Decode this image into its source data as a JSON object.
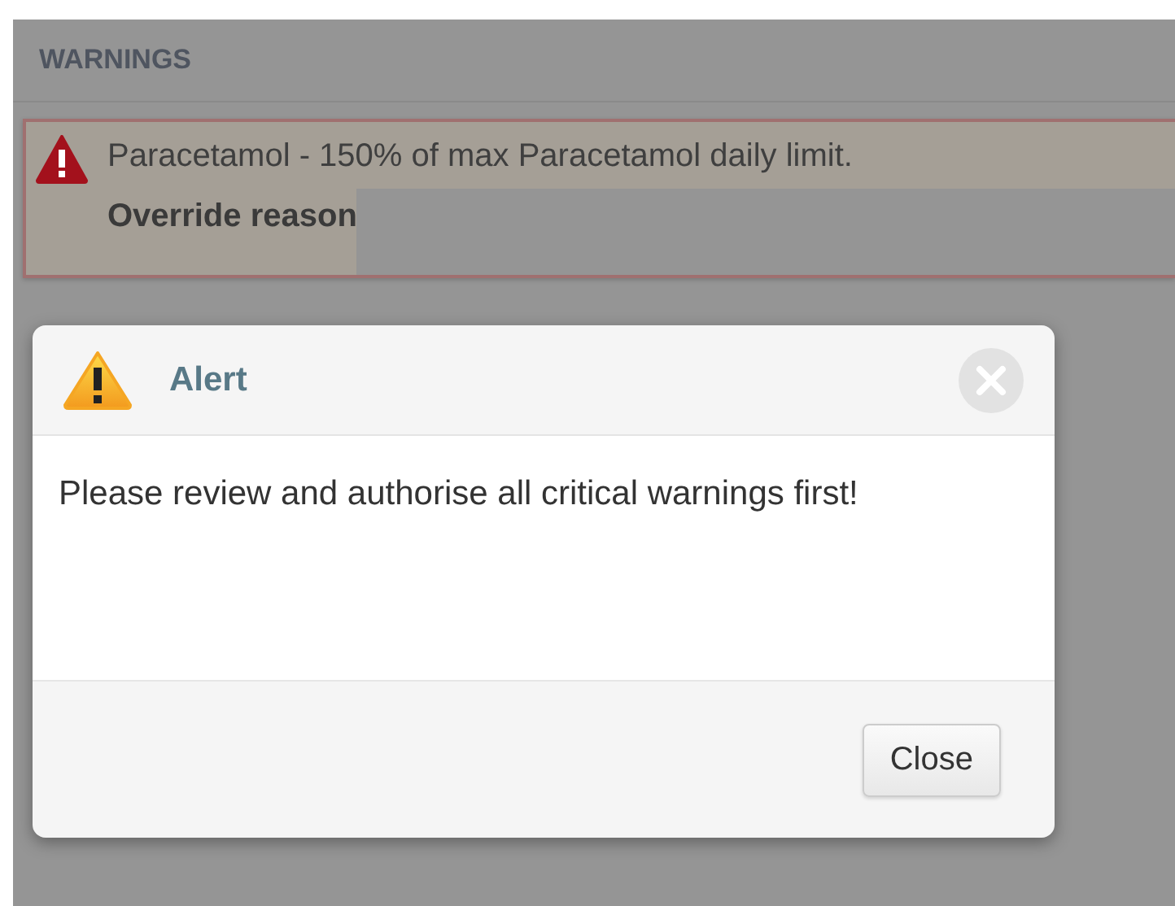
{
  "section": {
    "title": "WARNINGS"
  },
  "warnings": [
    {
      "message": "Paracetamol - 150% of max Paracetamol daily limit.",
      "label": "Override reason"
    }
  ],
  "dialog": {
    "title": "Alert",
    "message": "Please review and authorise all critical warnings first!",
    "buttons": [
      "Close"
    ]
  }
}
